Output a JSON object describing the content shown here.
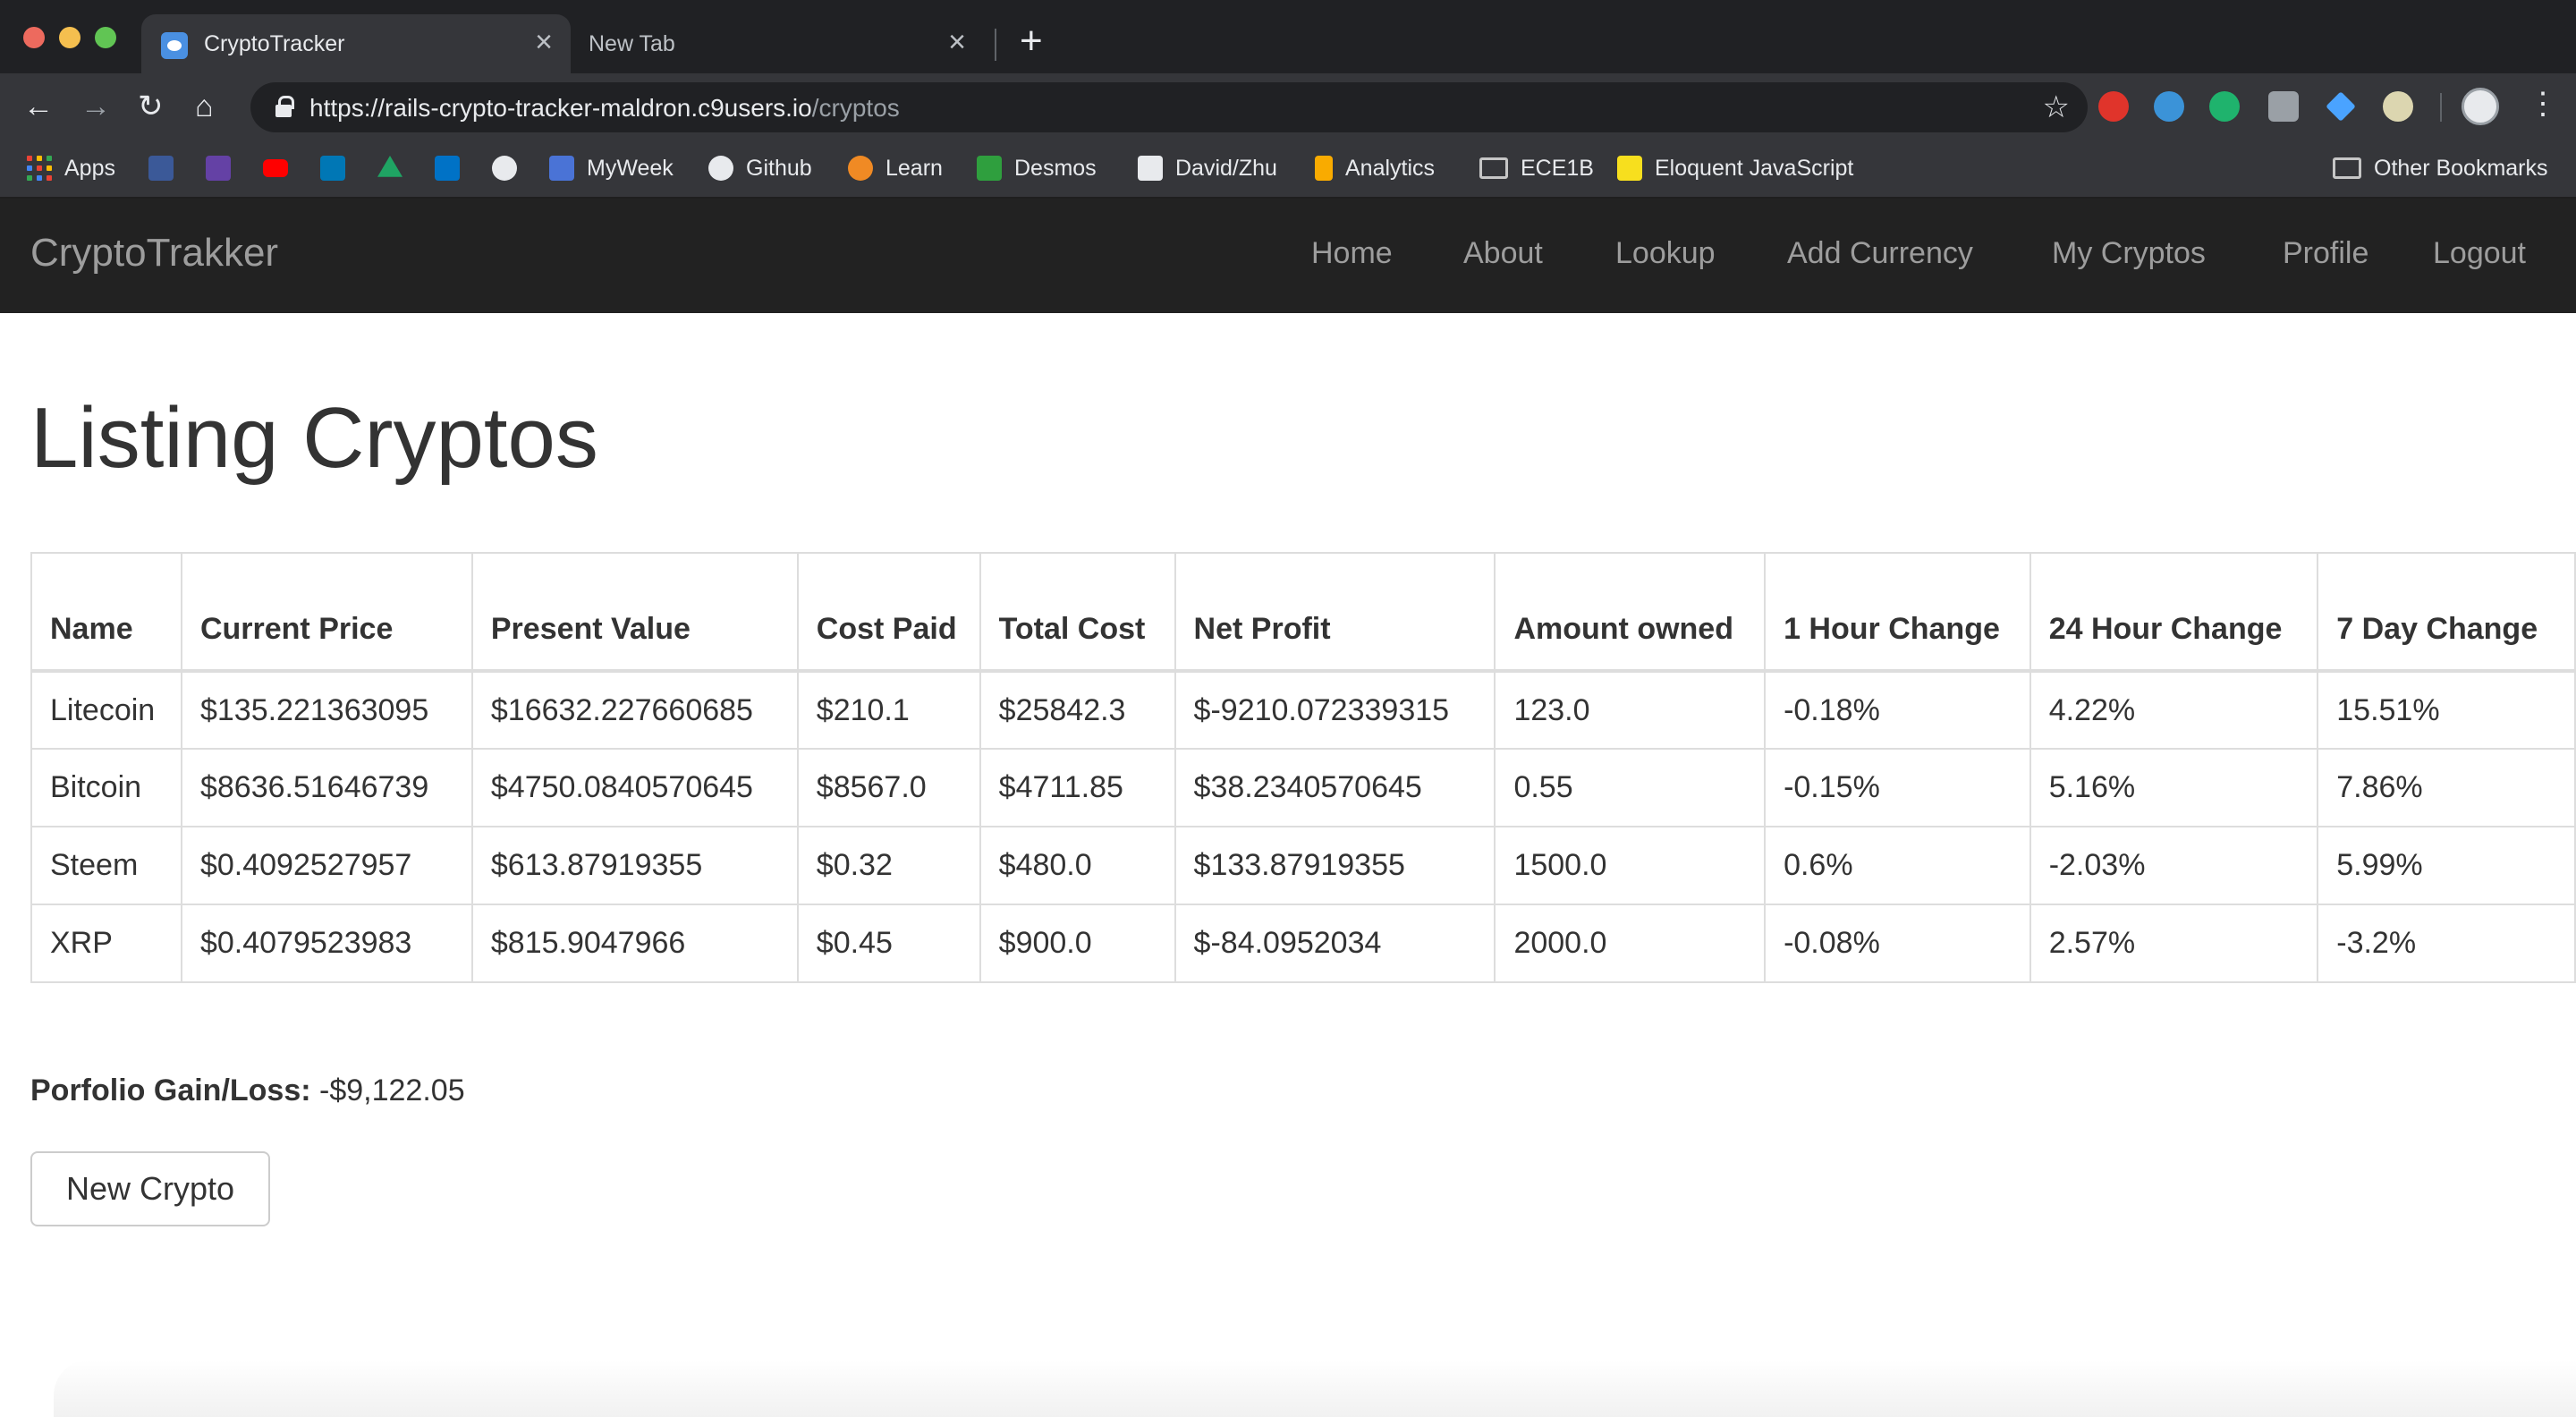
{
  "browser": {
    "tabs": [
      {
        "title": "CryptoTracker",
        "close": "×"
      },
      {
        "title": "New Tab",
        "close": "×"
      }
    ],
    "new_tab": "+",
    "nav": {
      "back": "←",
      "forward": "→",
      "reload": "↻",
      "home": "⌂"
    },
    "url_host": "https://rails-crypto-tracker-maldron.c9users.io",
    "url_path": "/cryptos",
    "star": "☆",
    "menu": "⋮",
    "bookmarks": [
      {
        "label": "Apps",
        "icon": "apps-grid-icon"
      },
      {
        "label": "",
        "icon": "facebook-icon",
        "color": "#3b5998"
      },
      {
        "label": "",
        "icon": "twitch-icon",
        "color": "#6441a5"
      },
      {
        "label": "",
        "icon": "youtube-icon",
        "color": "#ff0000"
      },
      {
        "label": "",
        "icon": "linkedin-icon",
        "color": "#0077b5"
      },
      {
        "label": "",
        "icon": "google-drive-icon",
        "color": "#1fa463"
      },
      {
        "label": "",
        "icon": "outlook-icon",
        "color": "#0072c6"
      },
      {
        "label": "",
        "icon": "globe-icon",
        "color": "#e8eaed"
      },
      {
        "label": "MyWeek",
        "icon": "calendar-icon",
        "color": "#4a73d6"
      },
      {
        "label": "Github",
        "icon": "github-icon",
        "color": "#e8eaed"
      },
      {
        "label": "Learn",
        "icon": "learn-icon",
        "color": "#f08a24"
      },
      {
        "label": "Desmos",
        "icon": "desmos-icon",
        "color": "#2f9f3e"
      },
      {
        "label": "David/Zhu",
        "icon": "code-icon",
        "color": "#e8eaed"
      },
      {
        "label": "Analytics",
        "icon": "analytics-icon",
        "color": "#f9ab00"
      },
      {
        "label": "ECE1B",
        "icon": "folder-icon"
      },
      {
        "label": "Eloquent JavaScript",
        "icon": "ejs-icon",
        "color": "#f7df1e"
      }
    ],
    "other_bookmarks": "Other Bookmarks"
  },
  "navbar": {
    "brand": "CryptoTrakker",
    "links": [
      "Home",
      "About",
      "Lookup",
      "Add Currency",
      "My Cryptos",
      "Profile",
      "Logout"
    ]
  },
  "main": {
    "title": "Listing Cryptos",
    "table": {
      "headers": [
        "Name",
        "Current Price",
        "Present Value",
        "Cost Paid",
        "Total Cost",
        "Net Profit",
        "Amount owned",
        "1 Hour Change",
        "24 Hour Change",
        "7 Day Change"
      ],
      "rows": [
        [
          "Litecoin",
          "$135.221363095",
          "$16632.227660685",
          "$210.1",
          "$25842.3",
          "$-9210.072339315",
          "123.0",
          "-0.18%",
          "4.22%",
          "15.51%"
        ],
        [
          "Bitcoin",
          "$8636.51646739",
          "$4750.0840570645",
          "$8567.0",
          "$4711.85",
          "$38.2340570645",
          "0.55",
          "-0.15%",
          "5.16%",
          "7.86%"
        ],
        [
          "Steem",
          "$0.4092527957",
          "$613.87919355",
          "$0.32",
          "$480.0",
          "$133.87919355",
          "1500.0",
          "0.6%",
          "-2.03%",
          "5.99%"
        ],
        [
          "XRP",
          "$0.4079523983",
          "$815.9047966",
          "$0.45",
          "$900.0",
          "$-84.0952034",
          "2000.0",
          "-0.08%",
          "2.57%",
          "-3.2%"
        ]
      ]
    },
    "portfolio_label": "Porfolio Gain/Loss:",
    "portfolio_value": "-$9,122.05",
    "new_button": "New Crypto"
  }
}
